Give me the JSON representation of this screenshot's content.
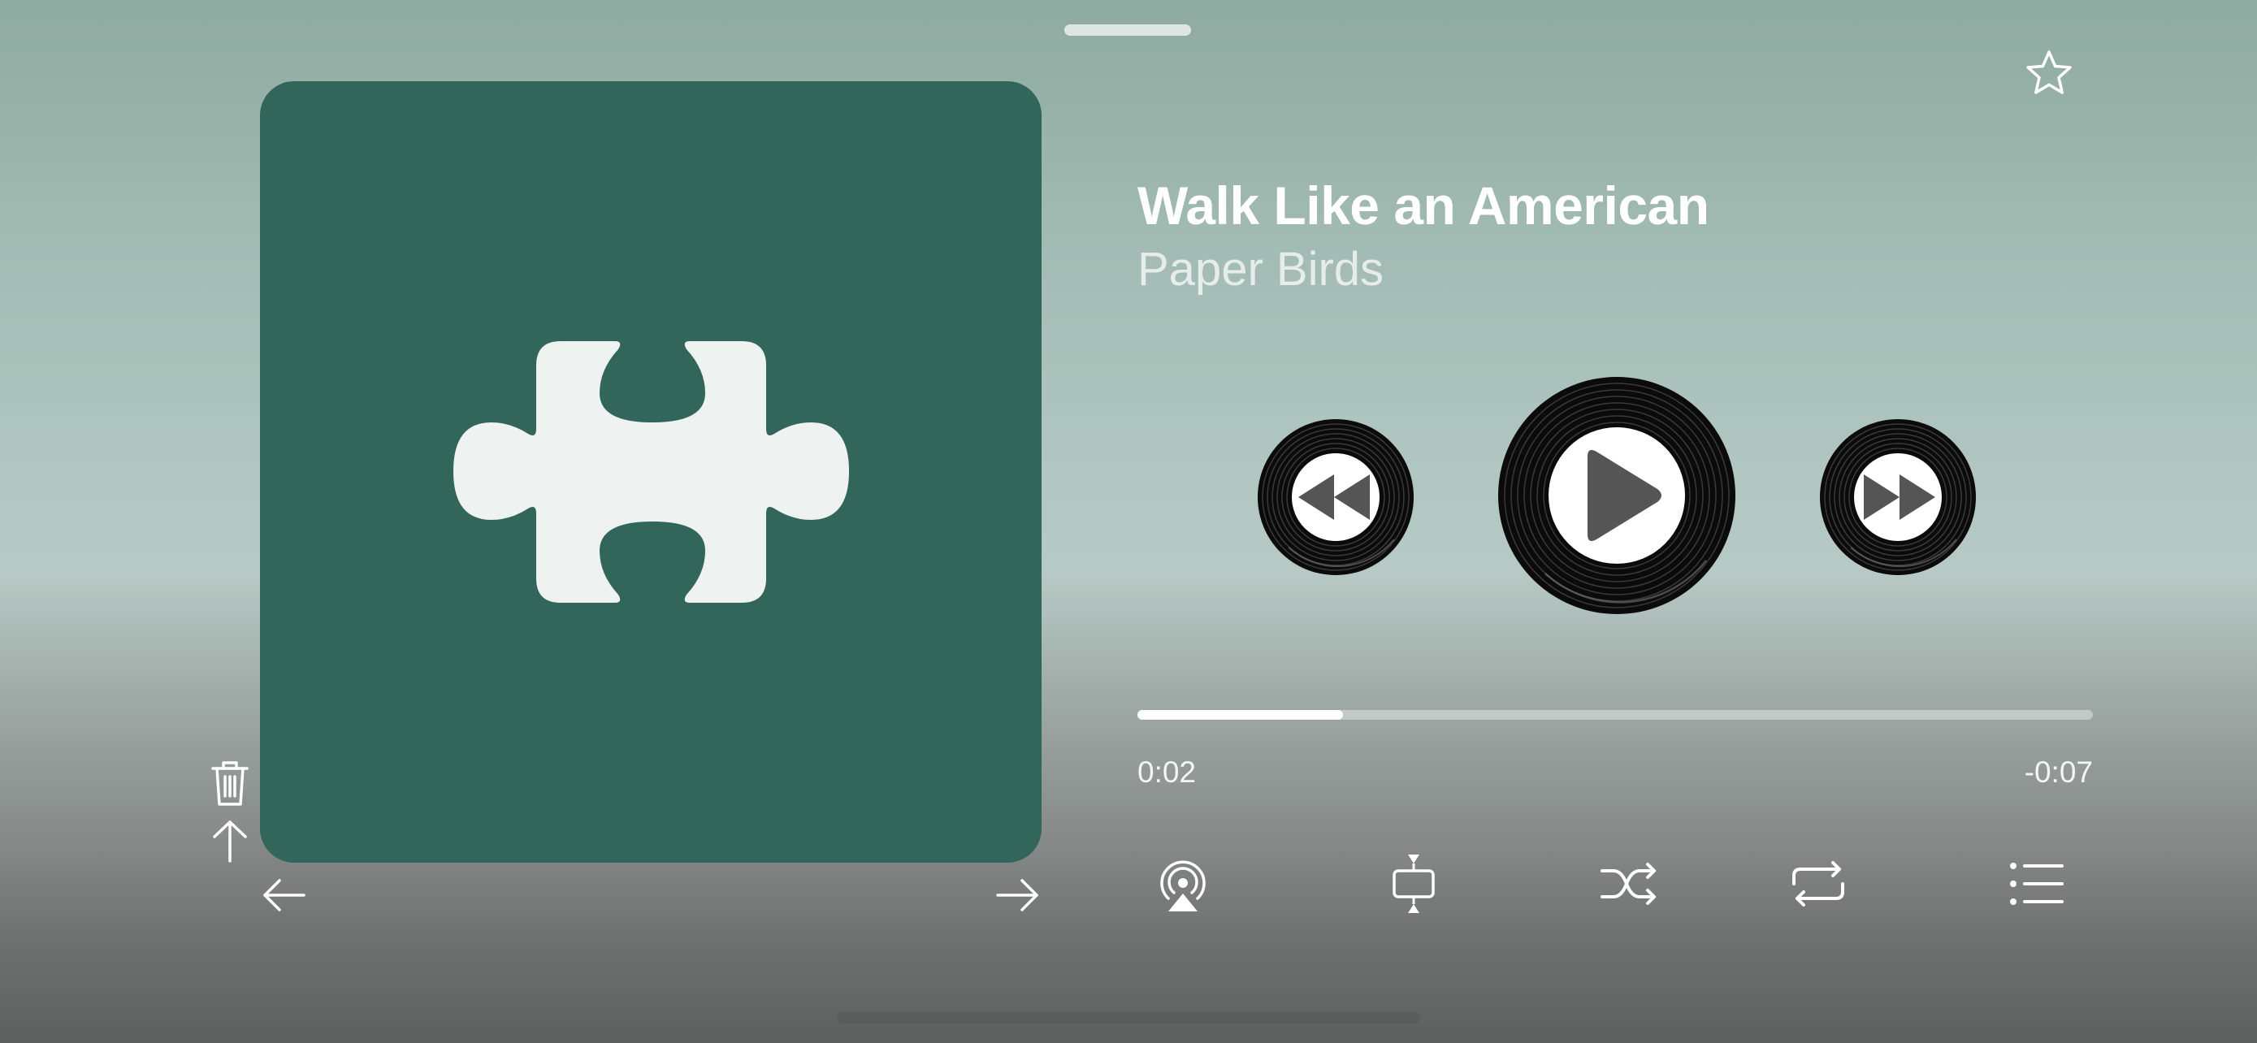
{
  "track": {
    "title": "Walk Like an American",
    "artist": "Paper Birds"
  },
  "playback": {
    "elapsed": "0:02",
    "remaining": "-0:07",
    "progress_fraction": 0.215
  },
  "icons": {
    "favorite": "star-icon",
    "artwork": "puzzle-piece-icon",
    "delete": "trash-icon",
    "move_up": "arrow-up-icon",
    "previous_item": "arrow-left-icon",
    "next_item": "arrow-right-icon",
    "rewind": "rewind-icon",
    "play": "play-icon",
    "fast_forward": "fast-forward-icon",
    "airplay": "airplay-icon",
    "fit": "fit-vertical-icon",
    "shuffle": "shuffle-icon",
    "repeat": "repeat-icon",
    "queue": "list-icon"
  },
  "colors": {
    "artwork_bg": "#33665a",
    "puzzle_fill": "#eef2f0",
    "disc_glyph": "#555555"
  }
}
